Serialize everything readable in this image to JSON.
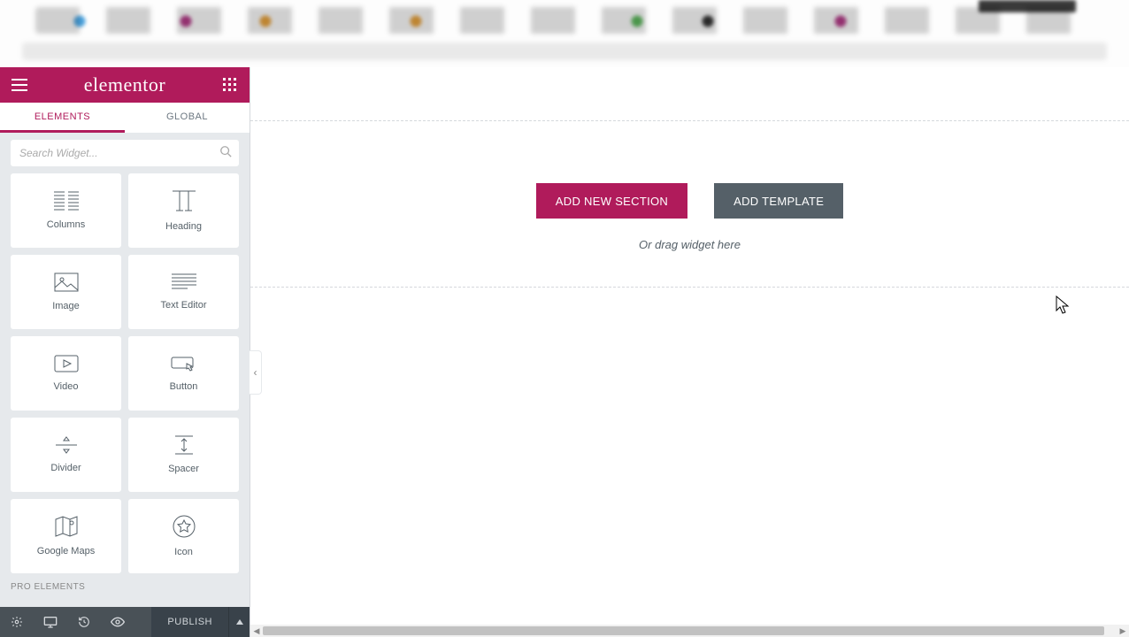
{
  "brand": "elementor",
  "tabs": {
    "elements": "ELEMENTS",
    "global": "GLOBAL"
  },
  "search": {
    "placeholder": "Search Widget..."
  },
  "widgets": [
    {
      "id": "columns",
      "label": "Columns"
    },
    {
      "id": "heading",
      "label": "Heading"
    },
    {
      "id": "image",
      "label": "Image"
    },
    {
      "id": "texteditor",
      "label": "Text Editor"
    },
    {
      "id": "video",
      "label": "Video"
    },
    {
      "id": "button",
      "label": "Button"
    },
    {
      "id": "divider",
      "label": "Divider"
    },
    {
      "id": "spacer",
      "label": "Spacer"
    },
    {
      "id": "googlemaps",
      "label": "Google Maps"
    },
    {
      "id": "icon",
      "label": "Icon"
    }
  ],
  "pro_section": "PRO ELEMENTS",
  "footer": {
    "publish": "PUBLISH"
  },
  "canvas": {
    "add_section": "ADD NEW SECTION",
    "add_template": "ADD TEMPLATE",
    "hint": "Or drag widget here"
  },
  "colors": {
    "accent": "#b01b5b",
    "panel": "#e6e9ec",
    "secondary": "#556068"
  }
}
